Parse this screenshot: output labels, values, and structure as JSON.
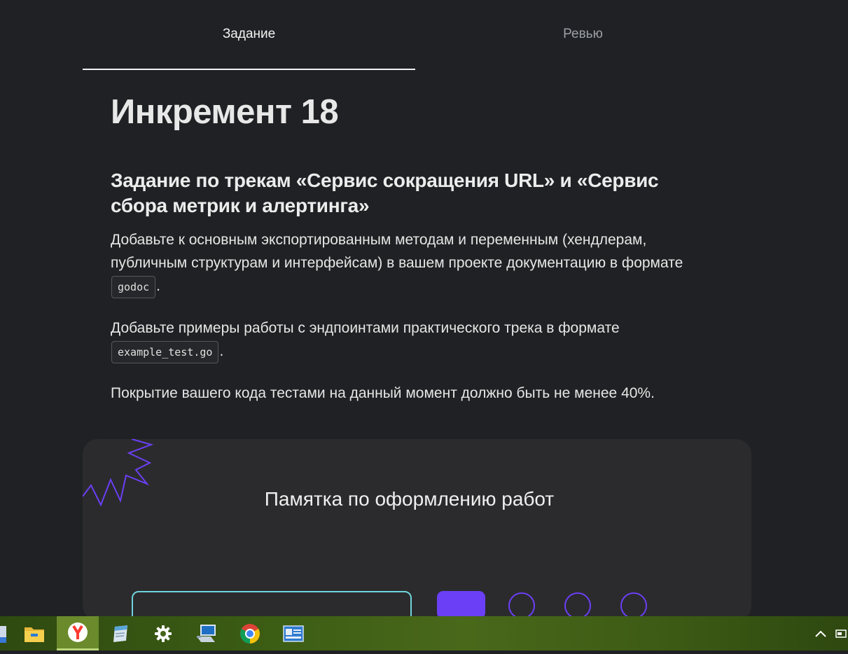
{
  "tabs": [
    {
      "label": "Задание",
      "active": true
    },
    {
      "label": "Ревью",
      "active": false
    }
  ],
  "title": "Инкремент 18",
  "subtitle": "Задание по трекам «Сервис сокращения URL» и «Сервис сбора метрик и алертинга»",
  "paragraphs": {
    "p1_text": "Добавьте к основным экспортированным методам и переменным (хендлерам, публичным структурам и интерфейсам) в вашем проекте документацию в формате",
    "p1_code": "godoc",
    "p1_end": ".",
    "p2_text": "Добавьте примеры работы с эндпоинтами практического трека в формате",
    "p2_code": "example_test.go",
    "p2_end": ".",
    "p3_text": "Покрытие вашего кода тестами на данный момент должно быть не менее 40%."
  },
  "card": {
    "title": "Памятка по оформлению работ"
  },
  "colors": {
    "accent": "#6b3ff5",
    "input_border": "#6fd3dc",
    "background": "#202124",
    "card": "#2b2b2d"
  },
  "taskbar": {
    "items": [
      {
        "icon": "file-explorer-icon"
      },
      {
        "icon": "yandex-browser-icon",
        "active": true
      },
      {
        "icon": "notepad-icon"
      },
      {
        "icon": "settings-gear-icon"
      },
      {
        "icon": "remote-desktop-icon"
      },
      {
        "icon": "chrome-icon"
      },
      {
        "icon": "control-panel-icon"
      }
    ],
    "tray": [
      "show-hidden-icons-chevron-icon",
      "tray-app-icon"
    ]
  }
}
